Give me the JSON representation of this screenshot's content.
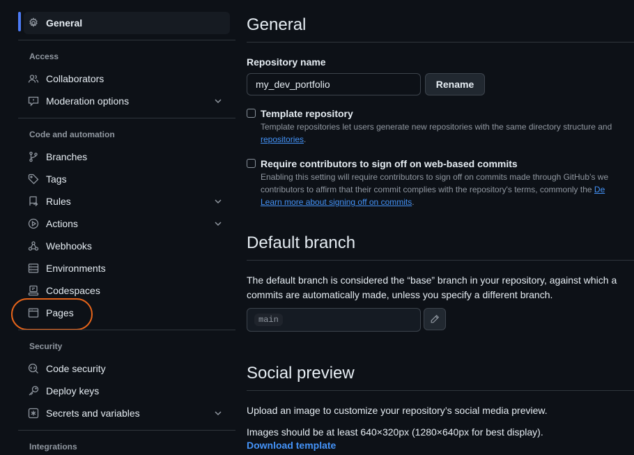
{
  "sidebar": {
    "active": {
      "label": "General",
      "icon": "gear-icon"
    },
    "groups": [
      {
        "heading": "Access",
        "items": [
          {
            "label": "Collaborators",
            "icon": "people-icon"
          },
          {
            "label": "Moderation options",
            "icon": "report-icon",
            "expandable": true
          }
        ]
      },
      {
        "heading": "Code and automation",
        "items": [
          {
            "label": "Branches",
            "icon": "branch-icon"
          },
          {
            "label": "Tags",
            "icon": "tag-icon"
          },
          {
            "label": "Rules",
            "icon": "repo-push-icon",
            "expandable": true
          },
          {
            "label": "Actions",
            "icon": "play-icon",
            "expandable": true
          },
          {
            "label": "Webhooks",
            "icon": "webhook-icon"
          },
          {
            "label": "Environments",
            "icon": "server-icon"
          },
          {
            "label": "Codespaces",
            "icon": "codespaces-icon"
          },
          {
            "label": "Pages",
            "icon": "browser-icon",
            "highlighted": true
          }
        ]
      },
      {
        "heading": "Security",
        "items": [
          {
            "label": "Code security",
            "icon": "codescan-icon"
          },
          {
            "label": "Deploy keys",
            "icon": "key-icon"
          },
          {
            "label": "Secrets and variables",
            "icon": "asterisk-icon",
            "expandable": true
          }
        ]
      },
      {
        "heading": "Integrations",
        "items": []
      }
    ]
  },
  "main": {
    "general_title": "General",
    "repo_name_label": "Repository name",
    "repo_name_value": "my_dev_portfolio",
    "rename_button": "Rename",
    "template": {
      "title": "Template repository",
      "desc_line1": "Template repositories let users generate new repositories with the same directory structure and",
      "desc_link": "repositories",
      "desc_tail": "."
    },
    "signoff": {
      "title": "Require contributors to sign off on web-based commits",
      "desc_line1": "Enabling this setting will require contributors to sign off on commits made through GitHub’s we",
      "desc_line2": "contributors to affirm that their commit complies with the repository's terms, commonly the ",
      "desc_line2_link": "De",
      "learn_more": "Learn more about signing off on commits",
      "learn_more_tail": "."
    },
    "default_branch": {
      "title": "Default branch",
      "desc_line1": "The default branch is considered the “base” branch in your repository, against which a",
      "desc_line2": "commits are automatically made, unless you specify a different branch.",
      "branch": "main",
      "edit_icon": "pencil-icon"
    },
    "social_preview": {
      "title": "Social preview",
      "desc_line1": "Upload an image to customize your repository’s social media preview.",
      "desc_line2": "Images should be at least 640×320px (1280×640px for best display).",
      "download": "Download template"
    }
  },
  "colors": {
    "background": "#0d1117",
    "accent_bar": "#4c7bf5",
    "link": "#4493f8",
    "highlight_ring": "#e8651a"
  }
}
